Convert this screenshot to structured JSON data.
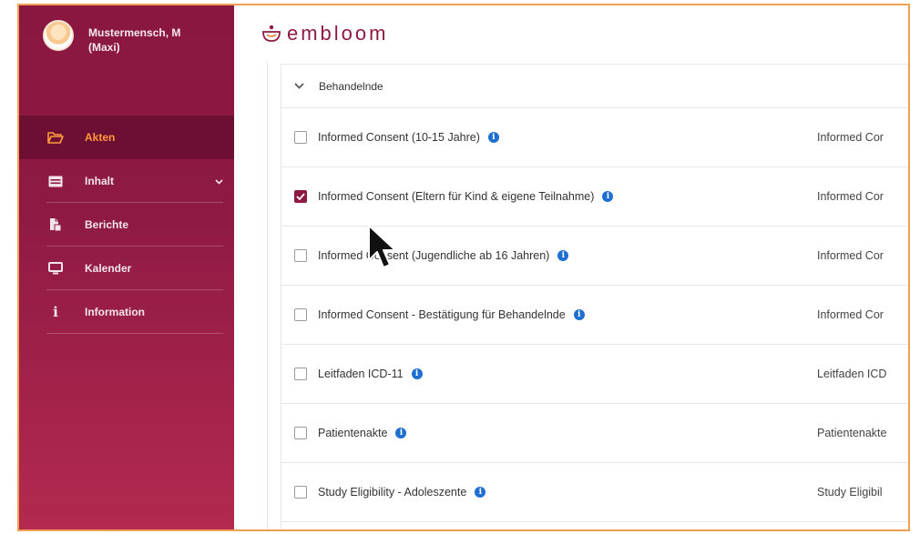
{
  "user": {
    "name_line1": "Mustermensch, M",
    "name_line2": "(Maxi)"
  },
  "nav": [
    {
      "label": "Akten",
      "icon": "folder-open-icon",
      "active": true
    },
    {
      "label": "Inhalt",
      "icon": "list-icon",
      "has_chevron": true
    },
    {
      "label": "Berichte",
      "icon": "document-copy-icon"
    },
    {
      "label": "Kalender",
      "icon": "monitor-icon"
    },
    {
      "label": "Information",
      "icon": "info-icon"
    }
  ],
  "brand": {
    "logo_text": "embloom",
    "accent": "#8e1a44",
    "active_nav": "#ff9a3c"
  },
  "group": {
    "label": "Behandelnde"
  },
  "rows": [
    {
      "label": "Informed Consent (10-15 Jahre)",
      "checked": false,
      "right": "Informed Cor"
    },
    {
      "label": "Informed Consent (Eltern für Kind & eigene Teilnahme)",
      "checked": true,
      "right": "Informed Cor"
    },
    {
      "label": "Informed Consent (Jugendliche ab 16 Jahren)",
      "checked": false,
      "right": "Informed Cor"
    },
    {
      "label": "Informed Consent - Bestätigung für Behandelnde",
      "checked": false,
      "right": "Informed Cor"
    },
    {
      "label": "Leitfaden ICD-11",
      "checked": false,
      "right": "Leitfaden ICD"
    },
    {
      "label": "Patientenakte",
      "checked": false,
      "right": "Patientenakte"
    },
    {
      "label": "Study Eligibility - Adoleszente",
      "checked": false,
      "right": "Study Eligibil"
    }
  ]
}
